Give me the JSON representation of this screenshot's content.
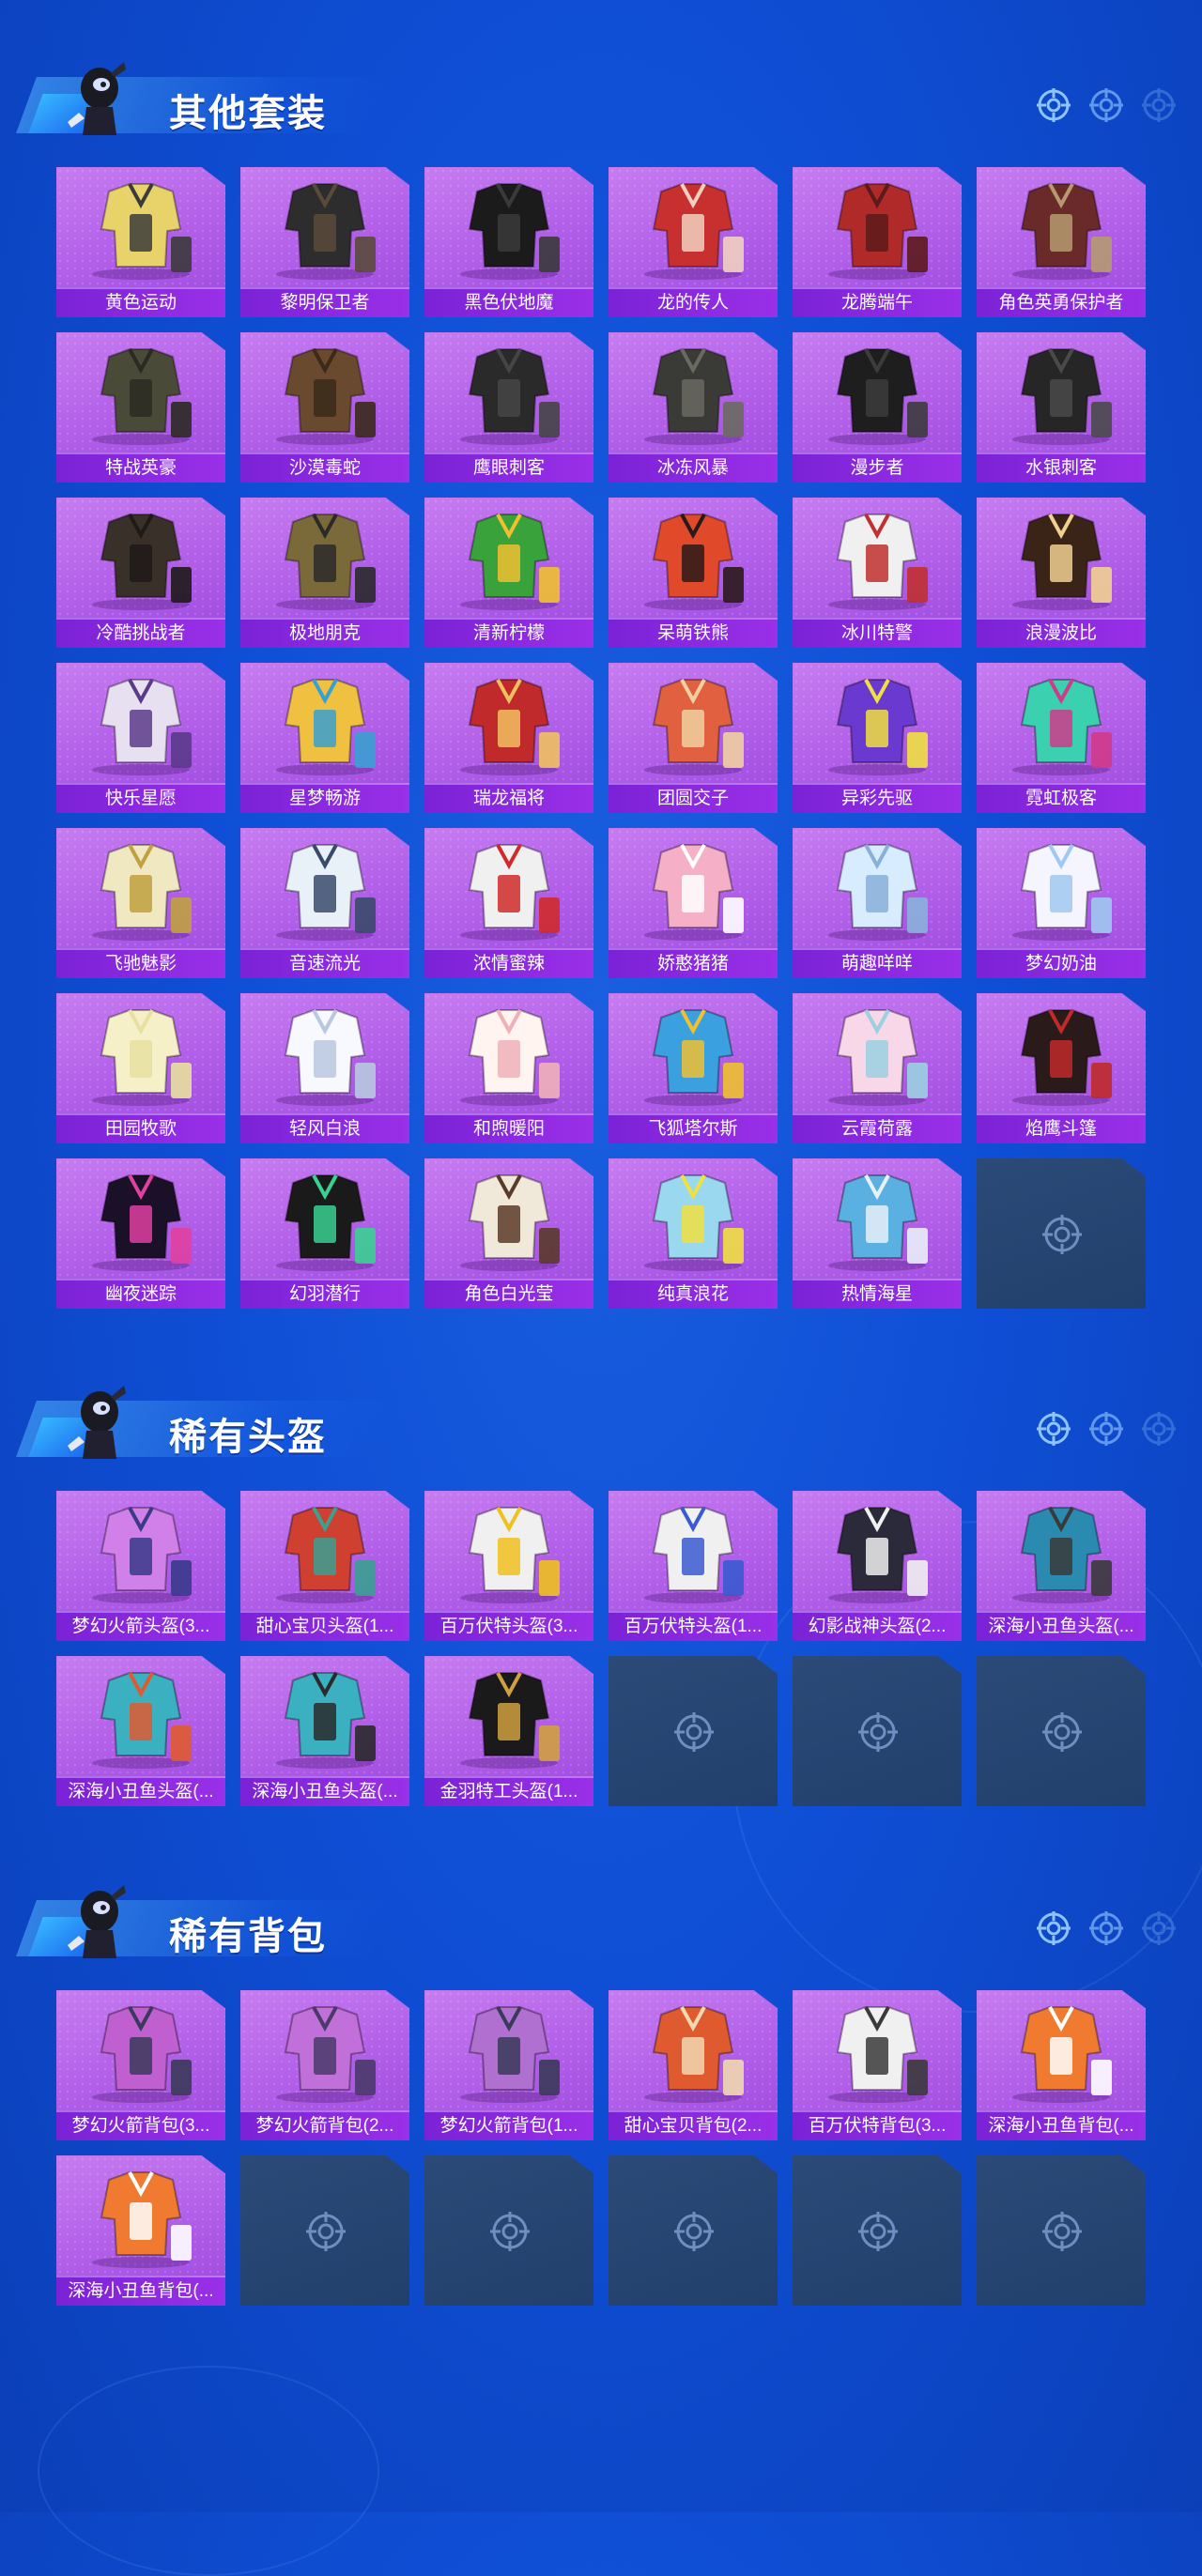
{
  "sections": [
    {
      "title": "其他套装",
      "cols": 6,
      "items": [
        {
          "label": "黄色运动",
          "palette": [
            "#e8d36b",
            "#3b3b3b"
          ]
        },
        {
          "label": "黎明保卫者",
          "palette": [
            "#2d2d2d",
            "#5a4a3a"
          ]
        },
        {
          "label": "黑色伏地魔",
          "palette": [
            "#1b1b1b",
            "#3a3a3a"
          ]
        },
        {
          "label": "龙的传人",
          "palette": [
            "#c83030",
            "#f1d0c0"
          ]
        },
        {
          "label": "龙腾端午",
          "palette": [
            "#b02a2a",
            "#5c1a1a"
          ]
        },
        {
          "label": "角色英勇保护者",
          "palette": [
            "#6a2a2a",
            "#b59a70"
          ]
        },
        {
          "label": "特战英豪",
          "palette": [
            "#4a4a38",
            "#2a2a22"
          ]
        },
        {
          "label": "沙漠毒蛇",
          "palette": [
            "#6a4a2e",
            "#3a2a1a"
          ]
        },
        {
          "label": "鹰眼刺客",
          "palette": [
            "#2a2a2a",
            "#454545"
          ]
        },
        {
          "label": "冰冻风暴",
          "palette": [
            "#3a3a36",
            "#6a6a60"
          ]
        },
        {
          "label": "漫步者",
          "palette": [
            "#1e1e1e",
            "#3c3c3c"
          ]
        },
        {
          "label": "水银刺客",
          "palette": [
            "#262626",
            "#4a4a4a"
          ]
        },
        {
          "label": "冷酷挑战者",
          "palette": [
            "#3a302a",
            "#1e1a18"
          ]
        },
        {
          "label": "极地朋克",
          "palette": [
            "#7a6a3a",
            "#2a2a2a"
          ]
        },
        {
          "label": "清新柠檬",
          "palette": [
            "#3aa23a",
            "#f0c030"
          ]
        },
        {
          "label": "呆萌铁熊",
          "palette": [
            "#e04a2a",
            "#2a1a1a"
          ]
        },
        {
          "label": "冰川特警",
          "palette": [
            "#f0f0f0",
            "#c03030"
          ]
        },
        {
          "label": "浪漫波比",
          "palette": [
            "#3a2418",
            "#f0d090"
          ]
        },
        {
          "label": "快乐星愿",
          "palette": [
            "#e6e0f0",
            "#5a3a8a"
          ]
        },
        {
          "label": "星梦畅游",
          "palette": [
            "#f0c040",
            "#3aa0d0"
          ]
        },
        {
          "label": "瑞龙福将",
          "palette": [
            "#c02a2a",
            "#f0c060"
          ]
        },
        {
          "label": "团圆交子",
          "palette": [
            "#e06040",
            "#f0d0a0"
          ]
        },
        {
          "label": "异彩先驱",
          "palette": [
            "#6a3ad0",
            "#f0e040"
          ]
        },
        {
          "label": "霓虹极客",
          "palette": [
            "#3ad0b0",
            "#d03a8a"
          ]
        },
        {
          "label": "飞驰魅影",
          "palette": [
            "#f0e8c0",
            "#c0a040"
          ]
        },
        {
          "label": "音速流光",
          "palette": [
            "#e8f0f8",
            "#3a4a6a"
          ]
        },
        {
          "label": "浓情蜜辣",
          "palette": [
            "#f0f0f0",
            "#d02a2a"
          ]
        },
        {
          "label": "娇憨猪猪",
          "palette": [
            "#f5b0c8",
            "#ffffff"
          ]
        },
        {
          "label": "萌趣咩咩",
          "palette": [
            "#d8ecff",
            "#8ab0d8"
          ]
        },
        {
          "label": "梦幻奶油",
          "palette": [
            "#f5f5ff",
            "#a0c8f0"
          ]
        },
        {
          "label": "田园牧歌",
          "palette": [
            "#f5f0c8",
            "#e8e0a0"
          ]
        },
        {
          "label": "轻风白浪",
          "palette": [
            "#f8f8ff",
            "#b8c8e0"
          ]
        },
        {
          "label": "和煦暖阳",
          "palette": [
            "#fff4f0",
            "#f0b0b8"
          ]
        },
        {
          "label": "飞狐塔尔斯",
          "palette": [
            "#3aa0e0",
            "#f0c030"
          ]
        },
        {
          "label": "云霞荷露",
          "palette": [
            "#f8d8e8",
            "#9ad0e0"
          ]
        },
        {
          "label": "焰鹰斗篷",
          "palette": [
            "#2a1a1a",
            "#c02a2a"
          ]
        },
        {
          "label": "幽夜迷踪",
          "palette": [
            "#1a1028",
            "#e040a0"
          ]
        },
        {
          "label": "幻羽潜行",
          "palette": [
            "#1a1a1a",
            "#3ad090"
          ]
        },
        {
          "label": "角色白光莹",
          "palette": [
            "#f0e8d8",
            "#5a3a2a"
          ]
        },
        {
          "label": "纯真浪花",
          "palette": [
            "#9ad8f0",
            "#f0e040"
          ]
        },
        {
          "label": "热情海星",
          "palette": [
            "#5ab0e0",
            "#e8f0f8"
          ]
        },
        {
          "label": ""
        }
      ]
    },
    {
      "title": "稀有头盔",
      "cols": 6,
      "items": [
        {
          "label": "梦幻火箭头盔(3...",
          "palette": [
            "#d080e8",
            "#3a3a8a"
          ]
        },
        {
          "label": "甜心宝贝头盔(1...",
          "palette": [
            "#d04030",
            "#3aa090"
          ]
        },
        {
          "label": "百万伏特头盔(3...",
          "palette": [
            "#f0f0f0",
            "#f0c020"
          ]
        },
        {
          "label": "百万伏特头盔(1...",
          "palette": [
            "#f0f0f0",
            "#3a5ad0"
          ]
        },
        {
          "label": "幻影战神头盔(2...",
          "palette": [
            "#2a2a3a",
            "#f0f0f0"
          ]
        },
        {
          "label": "深海小丑鱼头盔(...",
          "palette": [
            "#2a8ab0",
            "#3a3a3a"
          ]
        },
        {
          "label": "深海小丑鱼头盔(...",
          "palette": [
            "#3ab0c0",
            "#e05a30"
          ]
        },
        {
          "label": "深海小丑鱼头盔(...",
          "palette": [
            "#3ab0c0",
            "#2a2a2a"
          ]
        },
        {
          "label": "金羽特工头盔(1...",
          "palette": [
            "#1a1a1a",
            "#d0a040"
          ]
        },
        {
          "label": ""
        },
        {
          "label": ""
        },
        {
          "label": ""
        }
      ]
    },
    {
      "title": "稀有背包",
      "cols": 6,
      "items": [
        {
          "label": "梦幻火箭背包(3...",
          "palette": [
            "#c060d0",
            "#3a3a5a"
          ]
        },
        {
          "label": "梦幻火箭背包(2...",
          "palette": [
            "#c070d8",
            "#4a3a6a"
          ]
        },
        {
          "label": "梦幻火箭背包(1...",
          "palette": [
            "#b070d0",
            "#3a3a5a"
          ]
        },
        {
          "label": "甜心宝贝背包(2...",
          "palette": [
            "#e05a30",
            "#f0d8b0"
          ]
        },
        {
          "label": "百万伏特背包(3...",
          "palette": [
            "#f0f0f0",
            "#3a3a3a"
          ]
        },
        {
          "label": "深海小丑鱼背包(...",
          "palette": [
            "#f07a30",
            "#ffffff"
          ]
        },
        {
          "label": "深海小丑鱼背包(...",
          "palette": [
            "#f07a30",
            "#ffffff"
          ]
        },
        {
          "label": ""
        },
        {
          "label": ""
        },
        {
          "label": ""
        },
        {
          "label": ""
        },
        {
          "label": ""
        }
      ]
    }
  ]
}
